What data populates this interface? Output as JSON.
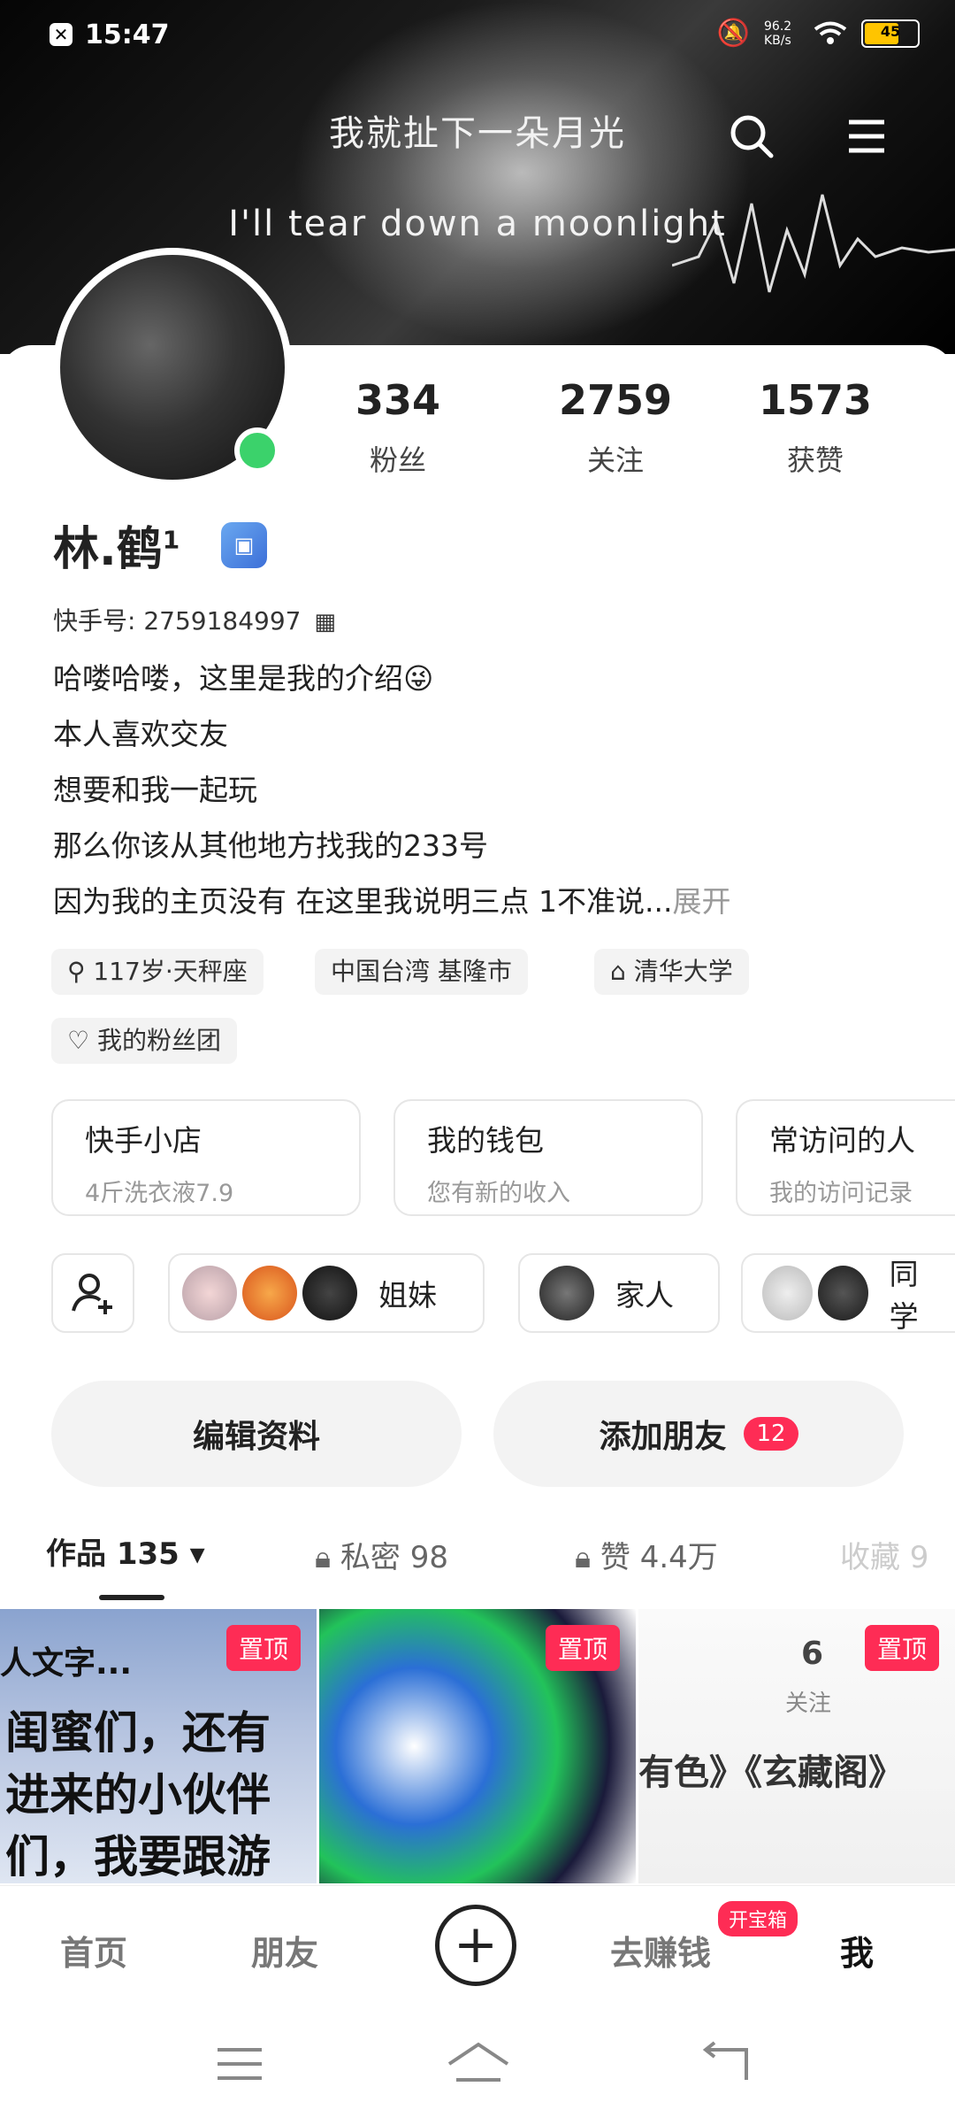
{
  "status_bar": {
    "time": "15:47",
    "net_speed": "96.2 KB/s",
    "battery": "45"
  },
  "banner": {
    "line1": "我就扯下一朵月光",
    "line2": "I'll tear down a moonlight"
  },
  "header_icons": [
    "search-icon",
    "menu-icon"
  ],
  "profile": {
    "name": "林.鹤",
    "name_sup": "1",
    "kuaishou_id_label": "快手号:",
    "kuaishou_id": "2759184997",
    "stats": [
      {
        "value": "334",
        "label": "粉丝"
      },
      {
        "value": "2759",
        "label": "关注"
      },
      {
        "value": "1573",
        "label": "获赞"
      }
    ],
    "bio_lines": [
      "哈喽哈喽，这里是我的介绍😜",
      "本人喜欢交友",
      "想要和我一起玩",
      "那么你该从其他地方找我的233号",
      "因为我的主页没有 在这里我说明三点 1不准说..."
    ],
    "bio_more": "展开",
    "tags": [
      {
        "icon": "search-icon",
        "text": "117岁·天秤座"
      },
      {
        "icon": "",
        "text": "中国台湾 基隆市"
      },
      {
        "icon": "graduation-cap-icon",
        "text": "清华大学"
      }
    ],
    "fan_group": "我的粉丝团"
  },
  "service_boxes": [
    {
      "title": "快手小店",
      "subtitle": "4斤洗衣液7.9"
    },
    {
      "title": "我的钱包",
      "subtitle": "您有新的收入"
    },
    {
      "title": "常访问的人",
      "subtitle": "我的访问记录"
    }
  ],
  "friend_groups": [
    {
      "label": "姐妹"
    },
    {
      "label": "家人"
    },
    {
      "label": "同学"
    }
  ],
  "buttons": {
    "edit_profile": "编辑资料",
    "add_friend": "添加朋友",
    "add_friend_count": "12"
  },
  "content_tabs": [
    {
      "label": "作品 135 ▾"
    },
    {
      "label": "私密 98"
    },
    {
      "label": "赞 4.4万"
    },
    {
      "label": "收藏 9"
    }
  ],
  "thumbnails": [
    {
      "pin": "置顶",
      "text1": "闺蜜们，还有",
      "text2": "进来的小伙伴",
      "text3": "们，我要跟游",
      "text0": "人文字..."
    },
    {
      "pin": "置顶"
    },
    {
      "pin": "置顶",
      "num": "6",
      "sub": "关注",
      "text": "有色》《玄藏阁》"
    }
  ],
  "bottom_nav": {
    "home": "首页",
    "friends": "朋友",
    "earn": "去赚钱",
    "earn_badge": "开宝箱",
    "me": "我"
  },
  "colors": {
    "accent": "#fe2c55",
    "online": "#3bd26b"
  }
}
